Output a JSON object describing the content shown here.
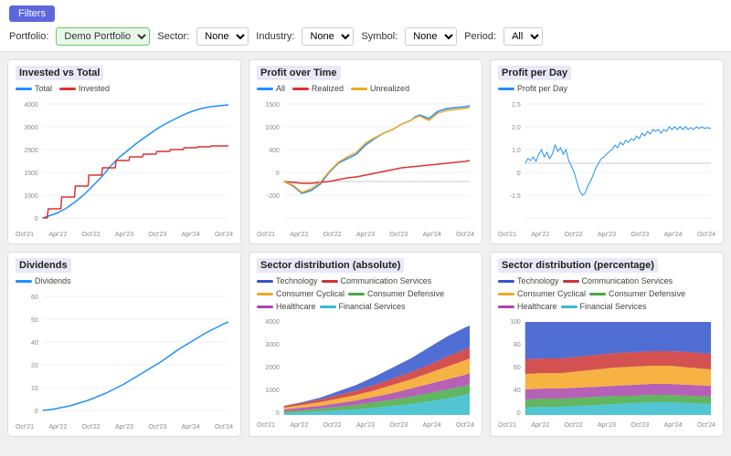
{
  "header": {
    "filters_button": "Filters",
    "portfolio_label": "Portfolio:",
    "portfolio_value": "Demo Portfolio",
    "sector_label": "Sector:",
    "sector_value": "None",
    "industry_label": "Industry:",
    "industry_value": "None",
    "symbol_label": "Symbol:",
    "symbol_value": "None",
    "period_label": "Period:",
    "period_value": "All"
  },
  "charts": [
    {
      "id": "invested-vs-total",
      "title": "Invested vs Total",
      "legend": [
        {
          "label": "Total",
          "color": "#1e90ff"
        },
        {
          "label": "Invested",
          "color": "#e03030"
        }
      ]
    },
    {
      "id": "profit-over-time",
      "title": "Profit over Time",
      "legend": [
        {
          "label": "All",
          "color": "#1e90ff"
        },
        {
          "label": "Realized",
          "color": "#e03030"
        },
        {
          "label": "Unrealized",
          "color": "#f5a623"
        }
      ]
    },
    {
      "id": "profit-per-day",
      "title": "Profit per Day",
      "legend": [
        {
          "label": "Profit per Day",
          "color": "#1e90ff"
        }
      ]
    },
    {
      "id": "dividends",
      "title": "Dividends",
      "legend": [
        {
          "label": "Dividends",
          "color": "#1e90ff"
        }
      ]
    },
    {
      "id": "sector-dist-abs",
      "title": "Sector distribution (absolute)",
      "legend": [
        {
          "label": "Technology",
          "color": "#3355cc"
        },
        {
          "label": "Communication Services",
          "color": "#cc3333"
        },
        {
          "label": "Consumer Cyclical",
          "color": "#f5a623"
        },
        {
          "label": "Consumer Defensive",
          "color": "#44aa44"
        },
        {
          "label": "Healthcare",
          "color": "#aa44aa"
        },
        {
          "label": "Financial Services",
          "color": "#33bbcc"
        }
      ]
    },
    {
      "id": "sector-dist-pct",
      "title": "Sector distribution (percentage)",
      "legend": [
        {
          "label": "Technology",
          "color": "#3355cc"
        },
        {
          "label": "Communication Services",
          "color": "#cc3333"
        },
        {
          "label": "Consumer Cyclical",
          "color": "#f5a623"
        },
        {
          "label": "Consumer Defensive",
          "color": "#44aa44"
        },
        {
          "label": "Healthcare",
          "color": "#aa44aa"
        },
        {
          "label": "Financial Services",
          "color": "#33bbcc"
        }
      ]
    }
  ],
  "x_labels": [
    "Oct'21",
    "Apr'22",
    "Oct'22",
    "Apr'23",
    "Oct'23",
    "Apr'24",
    "Oct'24"
  ]
}
